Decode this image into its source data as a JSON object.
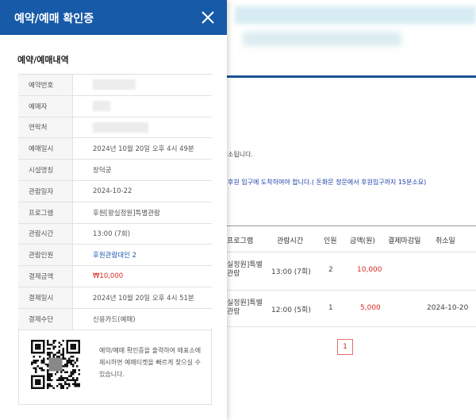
{
  "modal": {
    "title": "예약/예매 확인증",
    "section_title": "예약/예매내역",
    "rows": [
      {
        "label": "예약번호",
        "value": "",
        "masked": true,
        "mask_width": 54
      },
      {
        "label": "예매자",
        "value": "",
        "masked": true,
        "mask_width": 22
      },
      {
        "label": "연락처",
        "value": "",
        "masked": true,
        "mask_width": 70
      },
      {
        "label": "예매일시",
        "value": "2024년 10월 20일 오후 4시 49분"
      },
      {
        "label": "시설명칭",
        "value": "창덕궁"
      },
      {
        "label": "관람일자",
        "value": "2024-10-22"
      },
      {
        "label": "프로그램",
        "value": "후원[왕실정원]특별관람"
      },
      {
        "label": "관람시간",
        "value": "13:00 (7회)"
      },
      {
        "label": "관람인원",
        "value": "후원관람대인 2",
        "style": "blue"
      },
      {
        "label": "결제금액",
        "value": "₩10,000",
        "style": "red"
      },
      {
        "label": "결제일시",
        "value": "2024년 10월 20일 오후 4시 51분"
      },
      {
        "label": "결제수단",
        "value": "신용카드(예매)"
      }
    ],
    "qr_text": "예약/예매 확인증을 출력하여 매표소에 제시하면 예매티켓을 빠르게 찾으실 수있습니다."
  },
  "background": {
    "notice1": "소됩니다.",
    "notice2": "후원 입구에 도착하여야 합니다.( 돈화문 정문에서 후원입구까지 15분소요)",
    "table": {
      "headers": [
        "프로그램",
        "관람시간",
        "인원",
        "금액(원)",
        "결제마감일",
        "취소일"
      ],
      "rows": [
        {
          "program": "실정원]특별\n관람",
          "time": "13:00 (7회)",
          "count": "2",
          "amount": "10,000",
          "deadline": "",
          "cancel": ""
        },
        {
          "program": "실정원]특별\n관람",
          "time": "12:00 (5회)",
          "count": "1",
          "amount": "5,000",
          "deadline": "",
          "cancel": "2024-10-20"
        }
      ]
    },
    "pagination": {
      "current": "1"
    }
  }
}
